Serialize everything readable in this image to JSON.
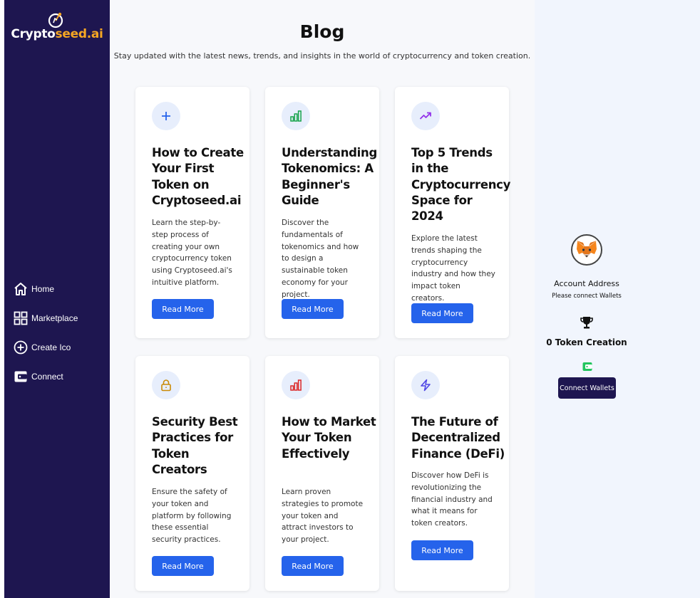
{
  "brand": {
    "name_part1": "Crypto",
    "name_part2": "seed.ai",
    "accent_color": "#f5a623",
    "sidebar_color": "#1e1650"
  },
  "sidebar": {
    "items": [
      {
        "label": "Home",
        "icon": "home-icon"
      },
      {
        "label": "Marketplace",
        "icon": "grid-icon"
      },
      {
        "label": "Create Ico",
        "icon": "plus-circle-icon"
      },
      {
        "label": "Connect",
        "icon": "wallet-icon"
      }
    ]
  },
  "page": {
    "title": "Blog",
    "subtitle": "Stay updated with the latest news, trends, and insights in the world of cryptocurrency and token creation."
  },
  "cards": [
    {
      "icon": "plus-icon",
      "icon_color": "#2563eb",
      "title": "How to Create Your First Token on Cryptoseed.ai",
      "description": "Learn the step-by-step process of creating your own cryptocurrency token using Cryptoseed.ai's intuitive platform.",
      "button": "Read More"
    },
    {
      "icon": "bar-chart-icon",
      "icon_color": "#16a34a",
      "title": "Understanding Tokenomics: A Beginner's Guide",
      "description": "Discover the fundamentals of tokenomics and how to design a sustainable token economy for your project.",
      "button": "Read More"
    },
    {
      "icon": "trending-up-icon",
      "icon_color": "#9333ea",
      "title": "Top 5 Trends in the Cryptocurrency Space for 2024",
      "description": "Explore the latest trends shaping the cryptocurrency industry and how they impact token creators.",
      "button": "Read More"
    },
    {
      "icon": "lock-icon",
      "icon_color": "#ca8a04",
      "title": "Security Best Practices for Token Creators",
      "description": "Ensure the safety of your token and platform by following these essential security practices.",
      "button": "Read More"
    },
    {
      "icon": "bar-chart-icon",
      "icon_color": "#dc2626",
      "title": "How to Market Your Token Effectively",
      "description": "Learn proven strategies to promote your token and attract investors to your project.",
      "button": "Read More"
    },
    {
      "icon": "lightning-icon",
      "icon_color": "#4f46e5",
      "title": "The Future of Decentralized Finance (DeFi)",
      "description": "Discover how DeFi is revolutionizing the financial industry and what it means for token creators.",
      "button": "Read More"
    }
  ],
  "account": {
    "avatar_icon": "metamask-fox-icon",
    "label": "Account Address",
    "sub": "Please connect Wallets",
    "token_count": "0 Token Creation",
    "trophy_icon": "trophy-icon",
    "wallet_icon": "wallet-icon",
    "connect_button": "Connect Wallets"
  }
}
